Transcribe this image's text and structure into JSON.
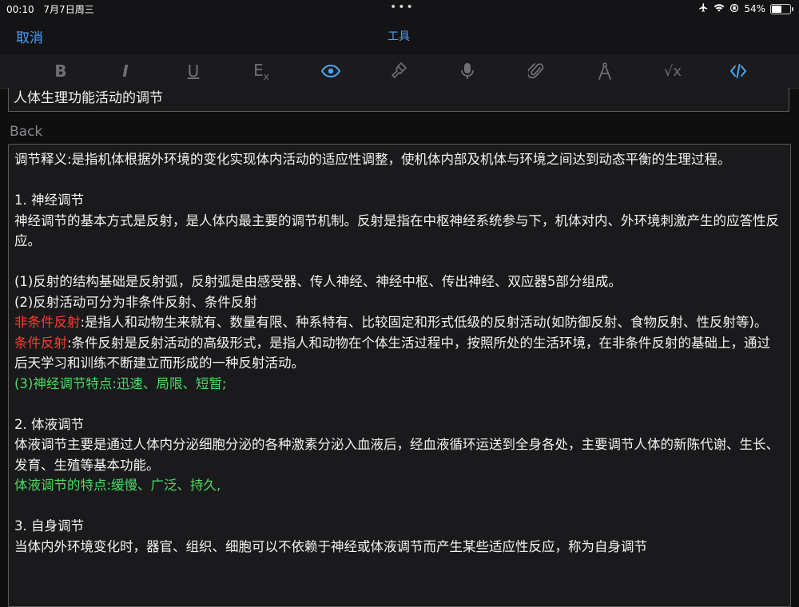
{
  "status": {
    "time": "00:10",
    "date": "7月7日周三",
    "dots": "•••",
    "battery": "54%",
    "battery_level": 0.54
  },
  "nav": {
    "cancel_label": "取消",
    "title": "工具"
  },
  "toolbar": {
    "bold": "B",
    "italic": "I",
    "underline": "U",
    "clear_format": "E",
    "clear_format_sub": "x",
    "sqrt": "√x"
  },
  "front": {
    "value": "人体生理功能活动的调节"
  },
  "back": {
    "label": "Back",
    "line1": "调节释义:是指机体根据外环境的变化实现体内活动的适应性调整，使机体内部及机体与环境之间达到动态平衡的生理过程。",
    "h1": "1. 神经调节",
    "p1": " 神经调节的基本方式是反射，是人体内最主要的调节机制。反射是指在中枢神经系统参与下，机体对内、外环境刺激产生的应答性反应。",
    "p2": "(1)反射的结构基础是反射弧，反射弧是由感受器、传人神经、神经中枢、传出神经、双应器5部分组成。",
    "p3": "(2)反射活动可分为非条件反射、条件反射",
    "r1_label": "非条件反射",
    "r1_text": ":是指人和动物生来就有、数量有限、种系特有、比较固定和形式低级的反射活动(如防御反射、食物反射、性反射等)。",
    "r2_label": "条件反射",
    "r2_text": ":条件反射是反射活动的高级形式，是指人和动物在个体生活过程中，按照所处的生活环境，在非条件反射的基础上，通过后天学习和训练不断建立而形成的一种反射活动。",
    "g1": "(3)神经调节特点:迅速、局限、短暂;",
    "h2": "2. 体液调节",
    "p4": "体液调节主要是通过人体内分泌细胞分泌的各种激素分泌入血液后，经血液循环运送到全身各处，主要调节人体的新陈代谢、生长、发育、生殖等基本功能。",
    "g2": "体液调节的特点:缓慢、广泛、持久,",
    "h3": "3. 自身调节",
    "p5": "当体内外环境变化时，器官、组织、细胞可以不依赖于神经或体液调节而产生某些适应性反应，称为自身调节"
  }
}
